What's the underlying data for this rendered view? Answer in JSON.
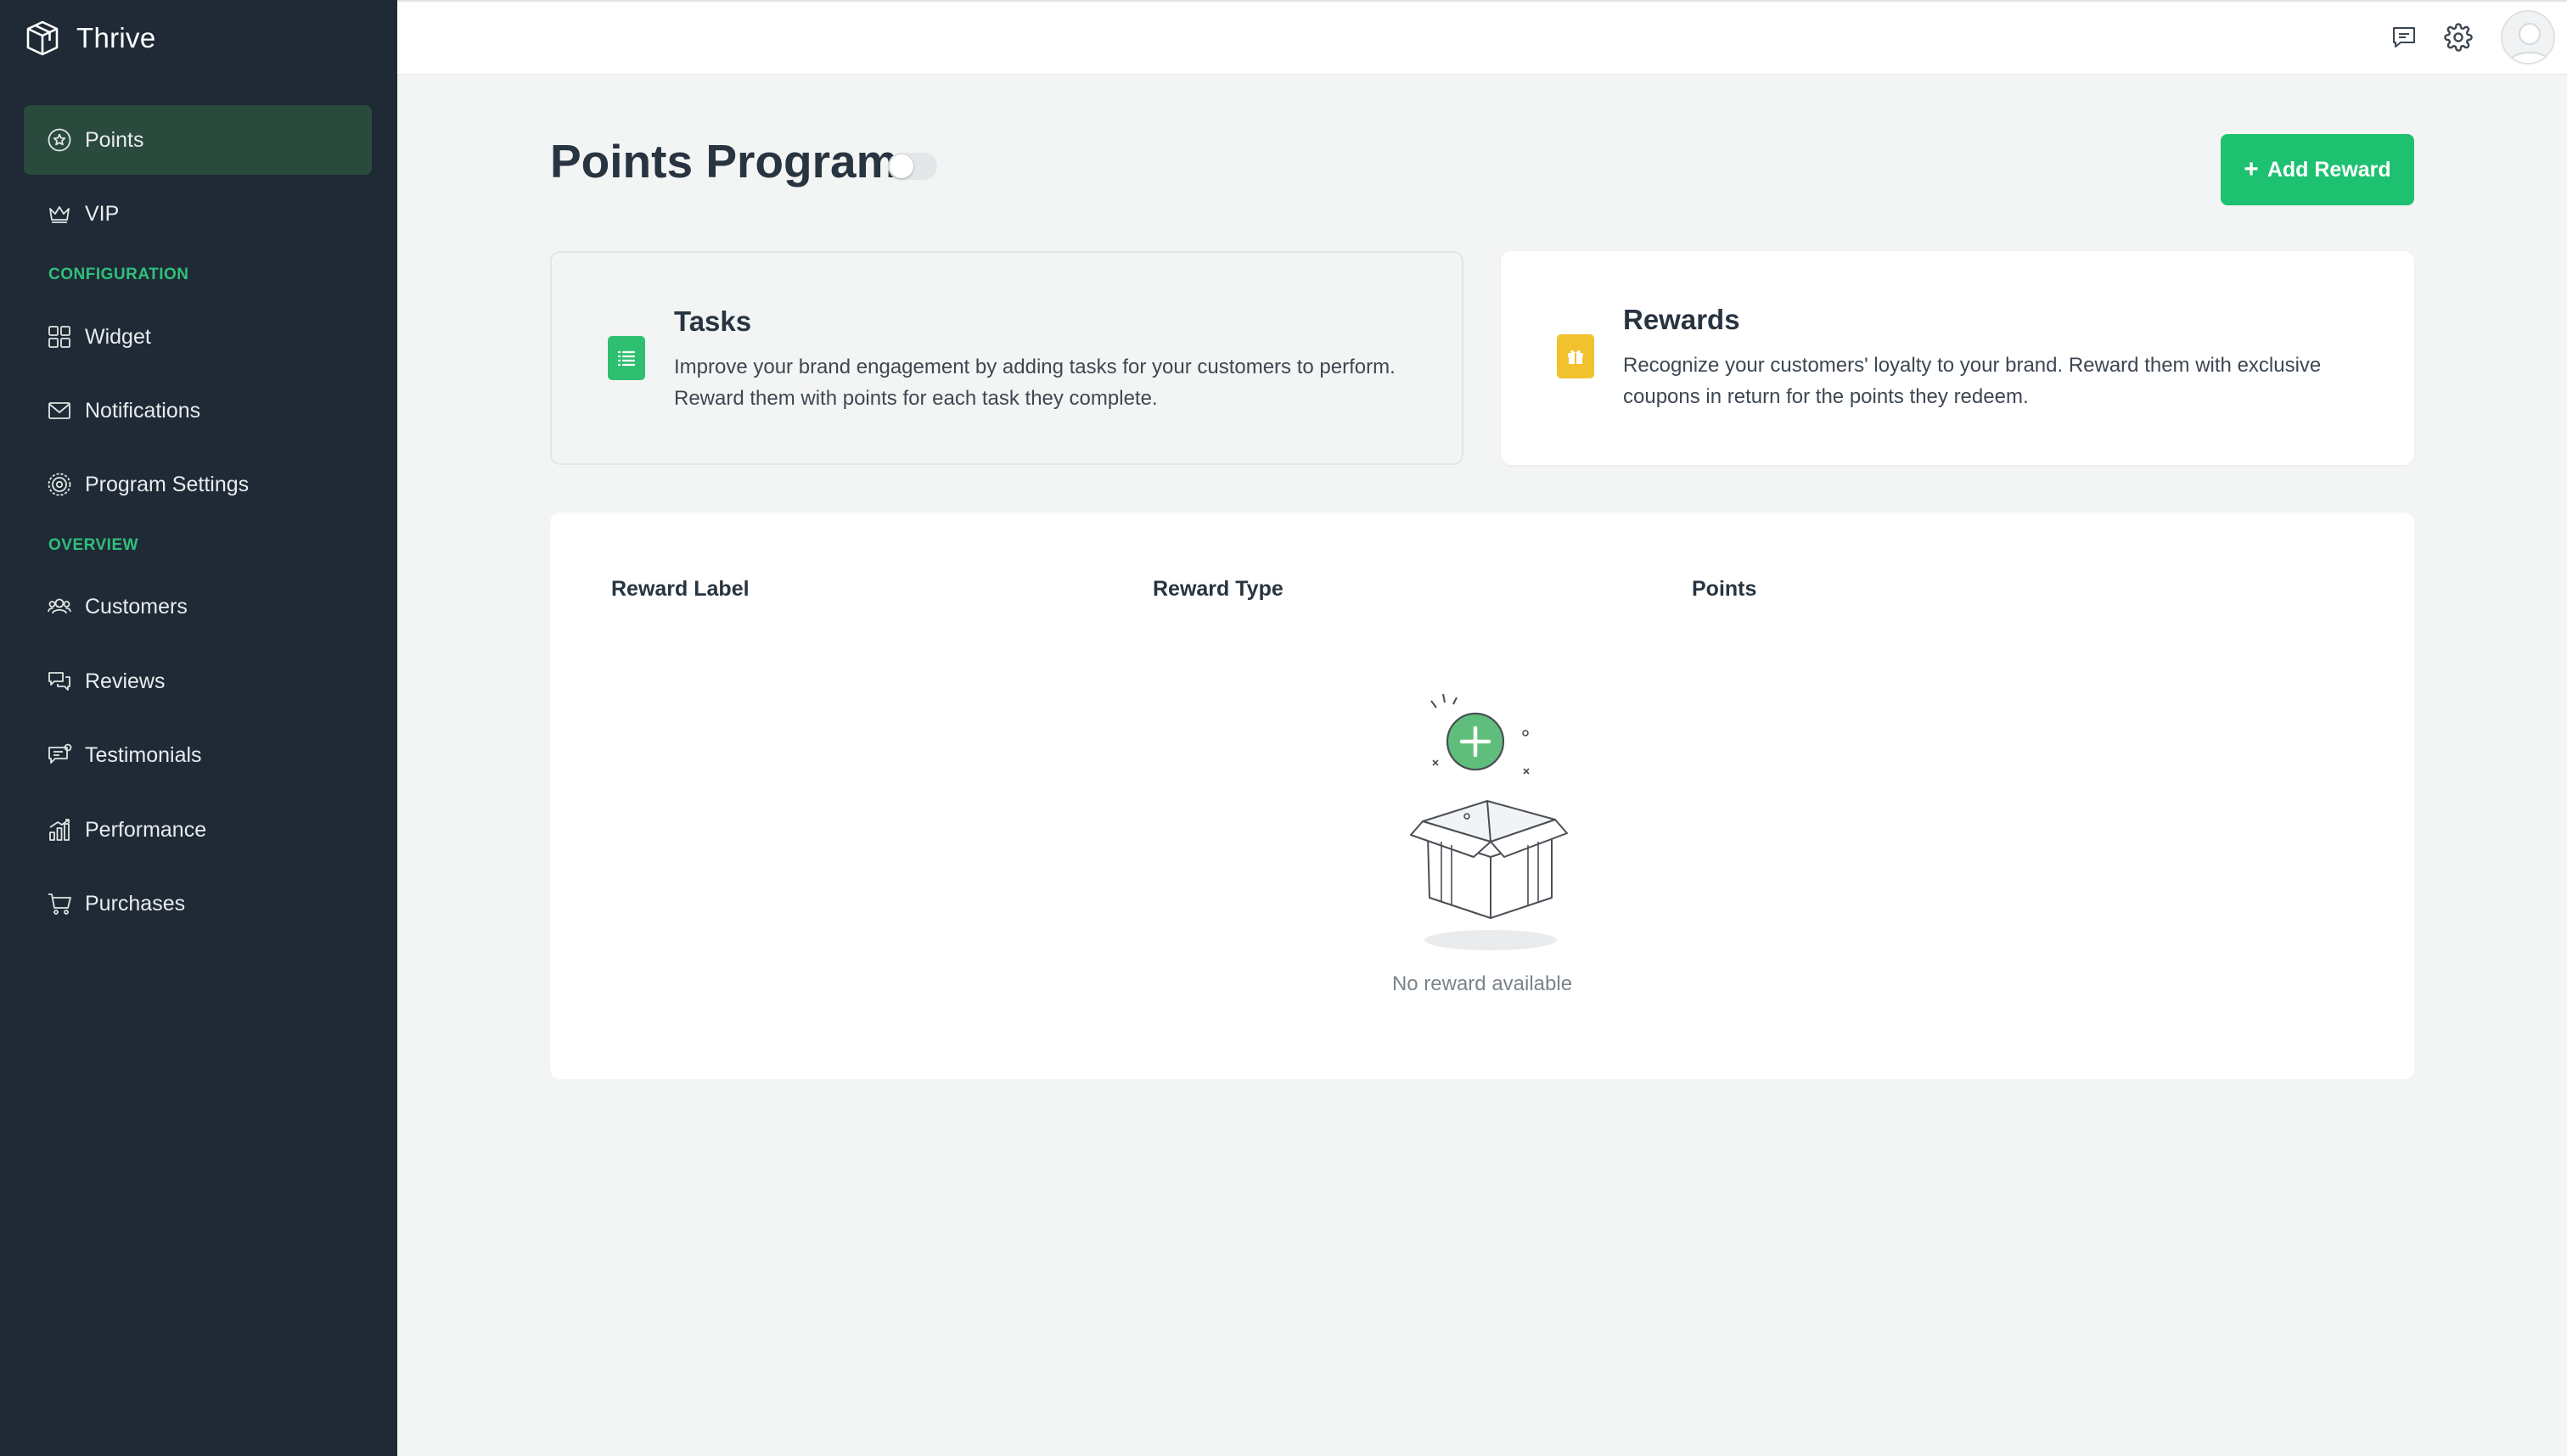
{
  "app": {
    "name": "Thrive"
  },
  "sidebar": {
    "items": [
      {
        "label": "Points",
        "icon": "star-badge-icon",
        "active": true
      },
      {
        "label": "VIP",
        "icon": "crown-icon"
      },
      {
        "label": "Widget",
        "icon": "grid-icon"
      },
      {
        "label": "Notifications",
        "icon": "envelope-icon"
      },
      {
        "label": "Program Settings",
        "icon": "settings-badge-icon"
      },
      {
        "label": "Customers",
        "icon": "users-icon"
      },
      {
        "label": "Reviews",
        "icon": "review-chat-icon"
      },
      {
        "label": "Testimonials",
        "icon": "testimonial-icon"
      },
      {
        "label": "Performance",
        "icon": "bar-chart-icon"
      },
      {
        "label": "Purchases",
        "icon": "cart-icon"
      }
    ],
    "sections": {
      "configuration": "CONFIGURATION",
      "overview": "OVERVIEW"
    }
  },
  "topbar": {
    "icons": [
      "chat-icon",
      "gear-icon",
      "avatar"
    ]
  },
  "page": {
    "title": "Points Program",
    "toggle_on": false,
    "add_button_label": "Add Reward"
  },
  "cards": {
    "tasks": {
      "title": "Tasks",
      "description": "Improve your brand engagement by adding tasks for your customers to perform. Reward them with points for each task they complete.",
      "icon": "list-doc-icon",
      "icon_color": "#2fbf71"
    },
    "rewards": {
      "title": "Rewards",
      "description": "Recognize your customers' loyalty to your brand. Reward them with exclusive coupons in return for the points they redeem.",
      "icon": "gift-icon",
      "icon_color": "#f2c12e"
    }
  },
  "table": {
    "columns": [
      "Reward Label",
      "Reward Type",
      "Points"
    ],
    "rows": [],
    "empty_message": "No reward available"
  },
  "colors": {
    "sidebar_bg": "#1f2a36",
    "active_item_bg": "#2a4a3e",
    "accent_green": "#1ec170",
    "section_label": "#2fc07a",
    "page_bg": "#f3f5f4"
  }
}
